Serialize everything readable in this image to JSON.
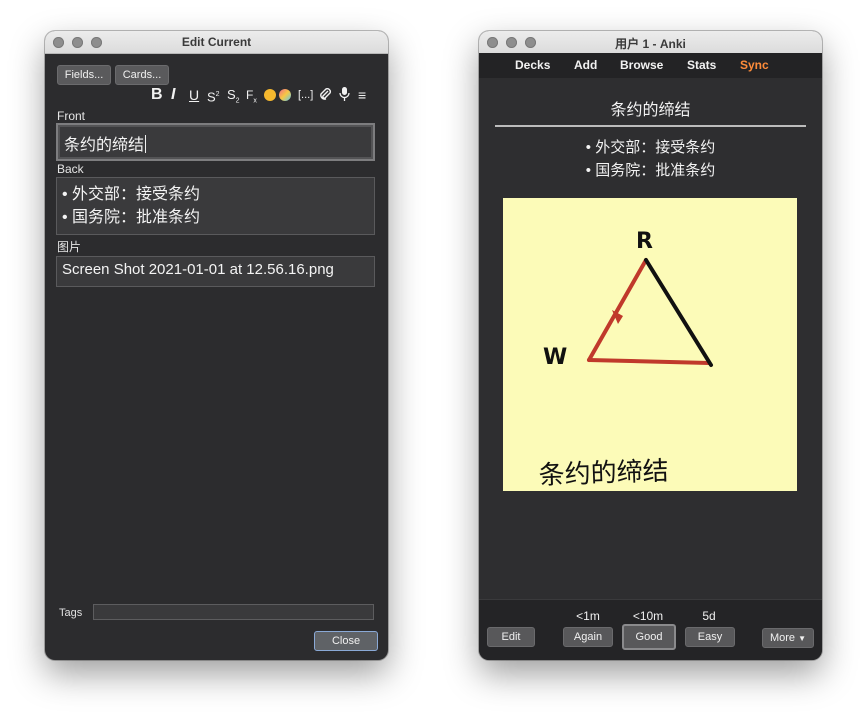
{
  "edit_window": {
    "title": "Edit Current",
    "buttons": {
      "fields": "Fields...",
      "cards": "Cards...",
      "close": "Close"
    },
    "toolbar_icons": [
      "bold-icon",
      "italic-icon",
      "underline-icon",
      "superscript-icon",
      "subscript-icon",
      "clear-format-icon",
      "text-color-icon",
      "highlight-color-icon",
      "cloze-icon",
      "attach-icon",
      "record-audio-icon",
      "more-menu-icon"
    ],
    "fields": [
      {
        "label": "Front",
        "value": "条约的缔结"
      },
      {
        "label": "Back",
        "lines": [
          "• 外交部：接受条约",
          "• 国务院：批准条约"
        ]
      },
      {
        "label": "图片",
        "value": "Screen Shot 2021-01-01 at 12.56.16.png"
      }
    ],
    "tags_label": "Tags",
    "tags_value": ""
  },
  "review_window": {
    "title": "用户 1 - Anki",
    "menu": [
      "Decks",
      "Add",
      "Browse",
      "Stats",
      "Sync"
    ],
    "sync_color": "#ff8c3a",
    "card": {
      "front": "条约的缔结",
      "back_lines": [
        "• 外交部：接受条约",
        "• 国务院：批准条约"
      ],
      "image": {
        "background": "#fcfbb8",
        "label_r": "R",
        "label_w": "W",
        "handwriting": "条约的缔结",
        "red_color": "#c0392b"
      }
    },
    "edit_label": "Edit",
    "answers": [
      {
        "interval": "<1m",
        "label": "Again"
      },
      {
        "interval": "<10m",
        "label": "Good"
      },
      {
        "interval": "5d",
        "label": "Easy"
      }
    ],
    "more_label": "More"
  }
}
